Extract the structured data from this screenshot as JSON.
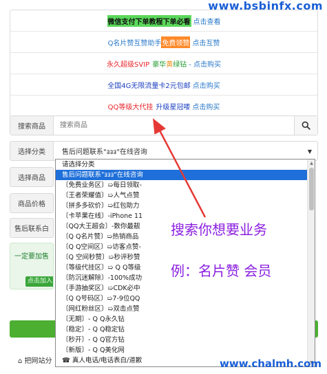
{
  "watermarks": {
    "top": "www.bsbinfx.com",
    "bottom": "www.chalmh.com"
  },
  "notices": {
    "n1": {
      "t1": "微信支付下单教程下单必看",
      "link": "点击查看"
    },
    "n2": {
      "t1": "Q名片赞互赞助手",
      "hl": "免费领赞",
      "link": "点击互赞"
    },
    "n3": {
      "t1": "永久超级SVIP",
      "t2": "豪华",
      "t3": "黄",
      "t4": "绿钻",
      "link": "- 点击购买"
    },
    "n4": {
      "t1": "全国4G无限流量卡2元包邮",
      "link": "点击购买"
    },
    "n5": {
      "t1": "QQ等级大代挂",
      "t2": "升级星冠喽",
      "link": "点击购买"
    }
  },
  "search": {
    "label": "搜索商品",
    "placeholder": "搜索商品",
    "icon": "search-icon"
  },
  "category": {
    "label": "选择分类",
    "value": "售后问题联系\"ⱻⱻⱻ\"在线咨询"
  },
  "side_labels": {
    "goods": "选择商品",
    "price": "商品价格",
    "contact": "售后联系白"
  },
  "tip": {
    "text": "一定要加售",
    "button": "点击加入"
  },
  "bottom_note": "把网站分",
  "dropdown": {
    "options": [
      "请选择分类",
      "售后问题联系\"ⱻⱻⱻ\"在线咨询",
      "〔免费业务区〕➯每日领取-",
      "〔王者荣耀值〕➯人气点赞",
      "〔拼多多砍价〕➯红包助力",
      "〔卡苹果在线〕-iPhone 11",
      "〔QQ大王超会〕-数你最靓",
      "〔Q Q名片赞〕➯热销商品",
      "〔Q Q空间区〕➯访客点赞-",
      "〔Q 空间秒赞〕➯秒评秒赞",
      "〔等级代挂区〕➯ Q Q等级",
      "〔防沉迷解除〕-100%成功",
      "〔手游抽奖区〕➯CDK必中",
      "〔Q Q号码区〕➯7-9位QQ",
      "〔网红粉丝区〕➯双击点赞",
      "〔无期〕- Q Q永久钻",
      "〔稳定〕- Q Q稳定钻",
      "〔秒开〕- Q Q官方钻",
      "〔新版〕- Q Q美化网",
      "☎ 真人电话/电话表白/道歉"
    ],
    "selected_index": 1
  },
  "annotations": {
    "line1": "搜索你想要业务",
    "line2": "例：名片赞  会员"
  },
  "colors": {
    "accent": "#2a79c9",
    "selected": "#1e6fd9",
    "annotation": "#8b1fe0",
    "arrow": "#e53935",
    "green_bar": "#4caf32"
  }
}
